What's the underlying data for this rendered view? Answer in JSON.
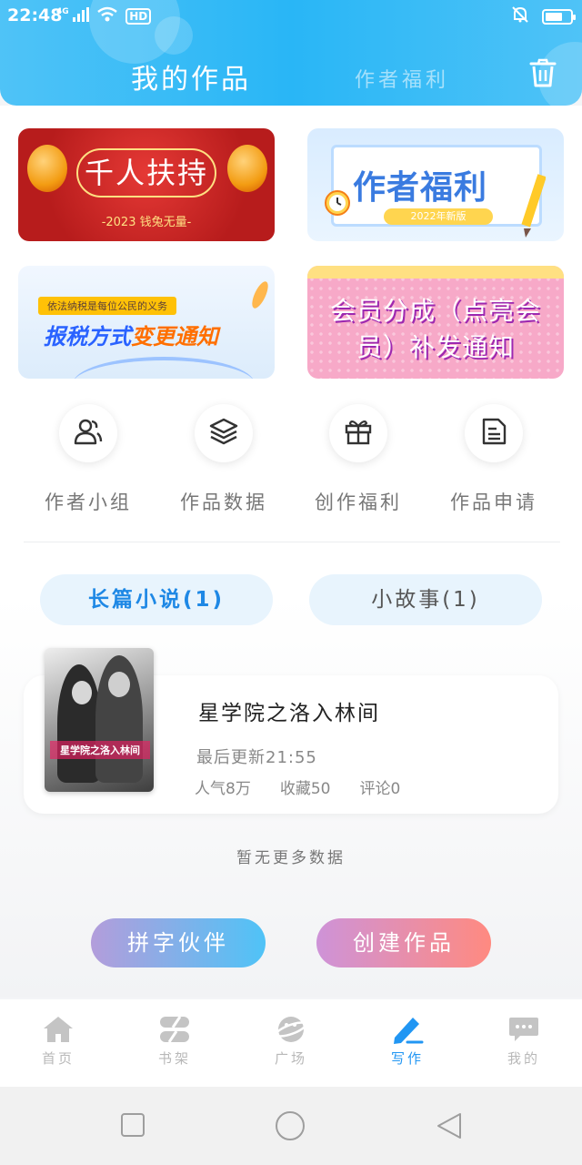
{
  "status": {
    "time": "22:48",
    "signal_text": "4G",
    "hd_text": "HD",
    "battery_level": 0.7
  },
  "header": {
    "active_tab": "我的作品",
    "inactive_tab": "作者福利",
    "trash_icon": "trash-icon"
  },
  "banners": [
    {
      "title": "千人扶持",
      "subtitle": "-2023 钱兔无量-"
    },
    {
      "title": "作者福利",
      "badge": "2022年新版"
    },
    {
      "tag": "依法纳税是每位公民的义务",
      "title_a": "报税方式",
      "title_b": "变更通知"
    },
    {
      "line1": "会员分成（点亮会",
      "line2": "员）补发通知"
    }
  ],
  "actions": [
    {
      "label": "作者小组",
      "icon": "people-icon"
    },
    {
      "label": "作品数据",
      "icon": "layers-icon"
    },
    {
      "label": "创作福利",
      "icon": "gift-icon"
    },
    {
      "label": "作品申请",
      "icon": "document-icon"
    }
  ],
  "tabs": {
    "novel": "长篇小说(1)",
    "story": "小故事(1)"
  },
  "work": {
    "cover_text": "星学院之洛入林间",
    "title": "星学院之洛入林间",
    "updated": "最后更新21:55",
    "popularity": "人气8万",
    "favorites": "收藏50",
    "comments": "评论0"
  },
  "no_more": "暂无更多数据",
  "buttons": {
    "partner": "拼字伙伴",
    "create": "创建作品"
  },
  "tabbar": [
    {
      "label": "首页",
      "icon": "home-icon",
      "active": false
    },
    {
      "label": "书架",
      "icon": "bookshelf-icon",
      "active": false
    },
    {
      "label": "广场",
      "icon": "planet-icon",
      "active": false
    },
    {
      "label": "写作",
      "icon": "pen-icon",
      "active": true
    },
    {
      "label": "我的",
      "icon": "chat-bubble-icon",
      "active": false
    }
  ],
  "colors": {
    "header": "#29b6f6",
    "accent": "#2196f3",
    "inactive": "#b8b8b8"
  }
}
